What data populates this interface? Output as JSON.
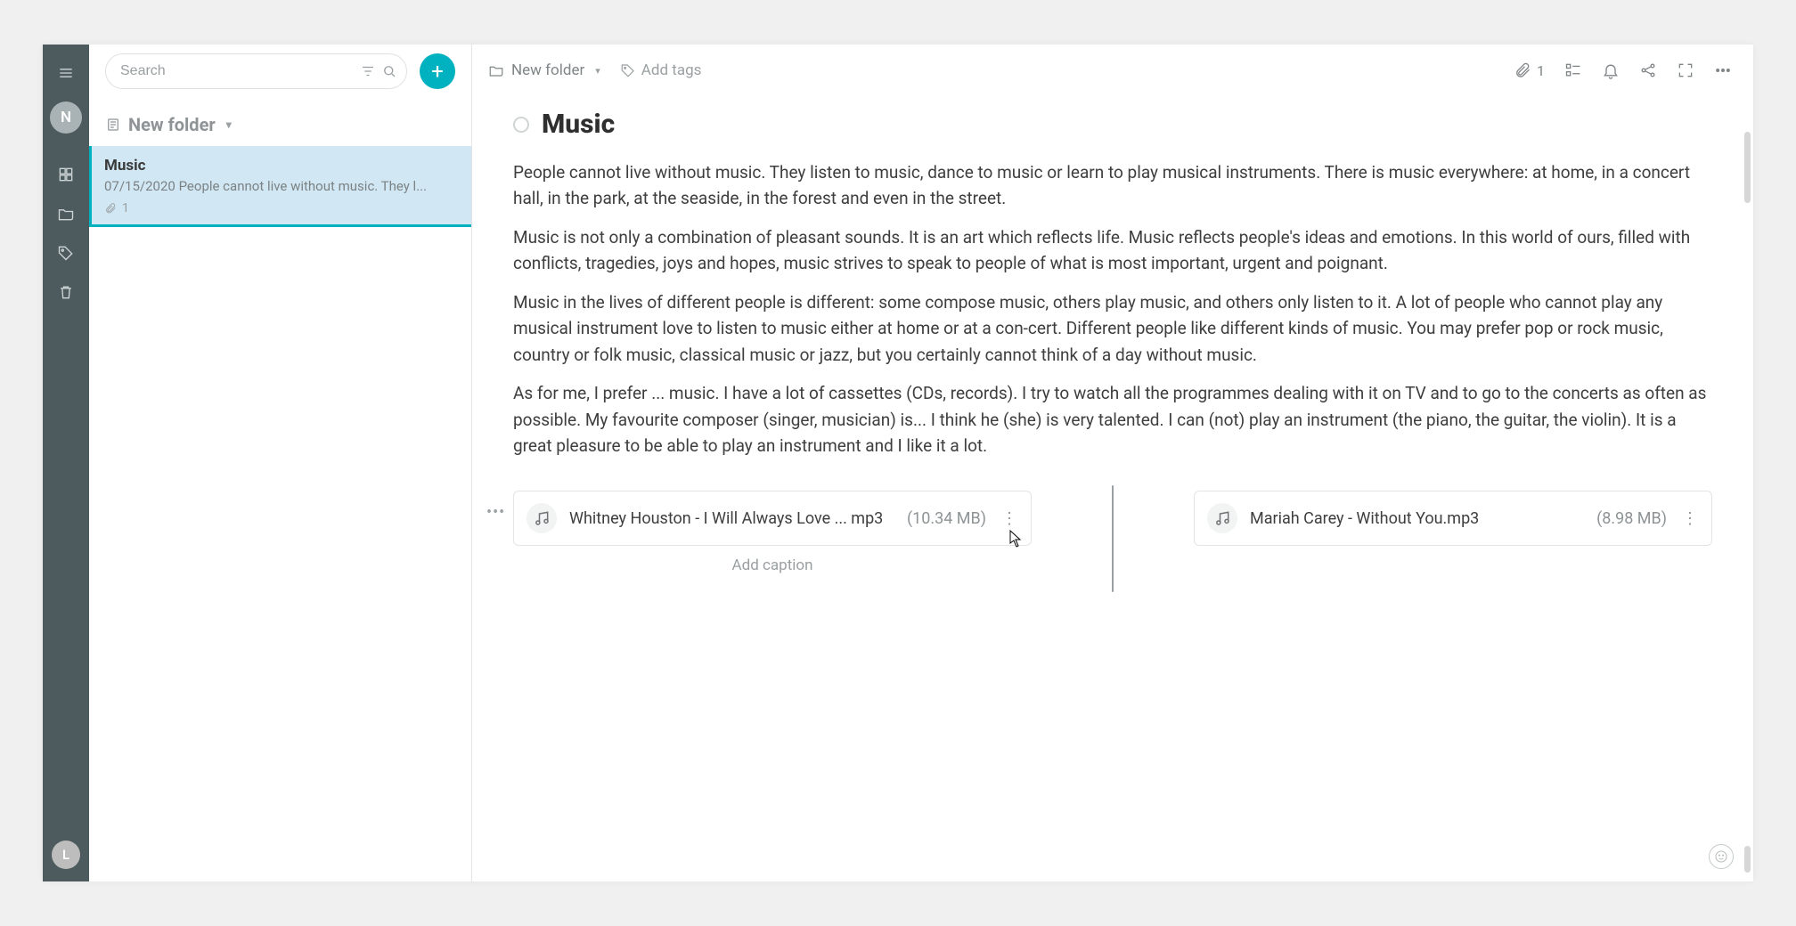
{
  "rail": {
    "avatar_top_letter": "N",
    "avatar_bottom_letter": "L"
  },
  "search": {
    "placeholder": "Search"
  },
  "list": {
    "folder_label": "New folder",
    "items": [
      {
        "title": "Music",
        "date": "07/15/2020",
        "preview": "People cannot live without music. They l...",
        "attach_count": "1"
      }
    ]
  },
  "header": {
    "breadcrumb_label": "New folder",
    "add_tags_label": "Add tags",
    "attachment_count": "1"
  },
  "note": {
    "title": "Music",
    "paragraphs": [
      "People cannot live without music. They listen to music, dance to music or learn to play musical instruments. There is music everywhere: at home, in a concert hall, in the park, at the seaside, in the forest and even in the street.",
      "Music is not only a combination of pleasant sounds. It is an art which reflects life. Music reflects people's ideas and emotions. In this world of ours, filled with conflicts, tragedies, joys and hopes, music strives to speak to people of what is most important, urgent and poignant.",
      "Music in the lives of different people is different: some compose music, others play music, and others only listen to it. A lot of people who cannot play any musical instrument love to listen to music either at home or at a con-cert. Different people like different kinds of music. You may prefer pop or rock music, country or folk music, classical music or jazz, but you certainly cannot think of a day without music.",
      "As for me, I prefer ... music. I have a lot of cassettes (CDs, records). I try to watch all the programmes dealing with it on TV and to go to the concerts as often as possible. My favourite composer (singer, musician) is... I think he (she) is very talented. I can (not) play an instrument (the piano, the guitar, the violin). It is a great pleasure to be able to play an instrument and I like it a lot."
    ],
    "attachments": [
      {
        "filename": "Whitney Houston - I Will Always Love ... mp3",
        "size": "(10.34 MB)"
      },
      {
        "filename": "Mariah Carey - Without You.mp3",
        "size": "(8.98 MB)"
      }
    ],
    "add_caption_label": "Add caption"
  }
}
